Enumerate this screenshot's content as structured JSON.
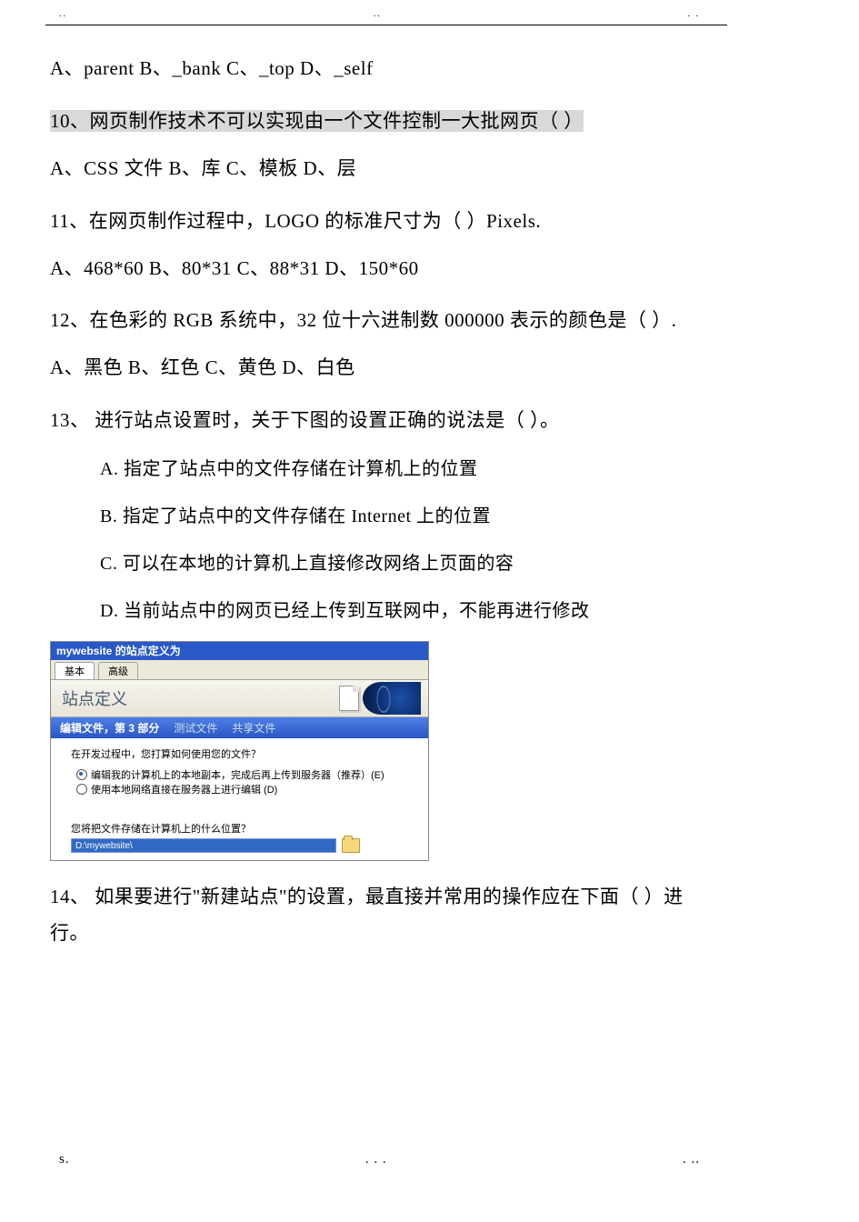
{
  "header_dots": {
    "left": "..",
    "mid": "..",
    "right": ". ."
  },
  "q9_options": "A、parent   B、_bank   C、_top   D、_self",
  "q10": "10、网页制作技术不可以实现由一个文件控制一大批网页（ ）",
  "q10_options": "A、CSS 文件   B、库   C、模板   D、层",
  "q11": "11、在网页制作过程中，LOGO 的标准尺寸为（ ）Pixels.",
  "q11_options": "A、468*60   B、80*31   C、88*31   D、150*60",
  "q12": "12、在色彩的 RGB 系统中，32 位十六进制数 000000 表示的颜色是（ ）.",
  "q12_options": "A、黑色   B、红色   C、黄色   D、白色",
  "q13": "13、   进行站点设置时，关于下图的设置正确的说法是（     ）。",
  "q13_A": "A.   指定了站点中的文件存储在计算机上的位置",
  "q13_B": "B.   指定了站点中的文件存储在 Internet 上的位置",
  "q13_C": "C.   可以在本地的计算机上直接修改网络上页面的容",
  "q13_D": "D.   当前站点中的网页已经上传到互联网中，不能再进行修改",
  "q14": "14、   如果要进行\"新建站点\"的设置，最直接并常用的操作应在下面（     ）进行。",
  "dialog": {
    "title": "mywebsite 的站点定义为",
    "tab_basic": "基本",
    "tab_adv": "高级",
    "header_label": "站点定义",
    "subhead_main": "编辑文件，第 3 部分",
    "subhead_test": "测试文件",
    "subhead_share": "共享文件",
    "q1": "在开发过程中，您打算如何使用您的文件？",
    "opt1": "编辑我的计算机上的本地副本，完成后再上传到服务器（推荐）(E)",
    "opt2": "使用本地网络直接在服务器上进行编辑 (D)",
    "q2": "您将把文件存储在计算机上的什么位置？",
    "path_value": "D:\\mywebsite\\"
  },
  "footer": {
    "left": "s.",
    "mid": ". . .",
    "right": ". .."
  }
}
